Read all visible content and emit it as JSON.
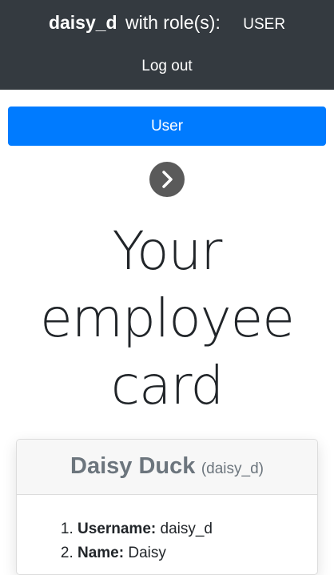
{
  "topbar": {
    "username": "daisy_d",
    "with_roles": "with role(s):",
    "role": "USER",
    "logout_label": "Log out"
  },
  "user_button_label": "User",
  "chevron_icon": "chevron-right-icon",
  "heading": {
    "line1": "Your",
    "line2": "employee",
    "line3": "card"
  },
  "card": {
    "full_name": "Daisy Duck",
    "handle": "(daisy_d)",
    "fields": [
      {
        "label": "Username:",
        "value": "daisy_d"
      },
      {
        "label": "Name:",
        "value": "Daisy"
      }
    ]
  },
  "colors": {
    "topbar": "#343a40",
    "primary": "#007bff",
    "muted": "#6c757d"
  }
}
